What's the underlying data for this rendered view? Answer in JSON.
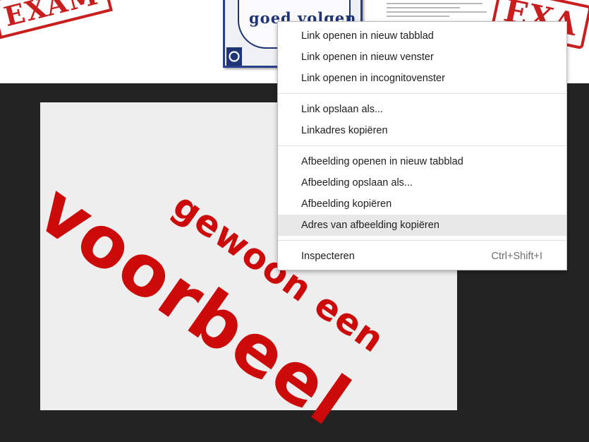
{
  "thumbnails": {
    "left_stamp": "EXAM",
    "tile_text": "goed volgen",
    "right_stamp": "EXA"
  },
  "main_image": {
    "line1": "gewoon een",
    "line2": "voorbeel"
  },
  "context_menu": {
    "groups": [
      [
        {
          "label": "Link openen in nieuw tabblad"
        },
        {
          "label": "Link openen in nieuw venster"
        },
        {
          "label": "Link openen in incognitovenster"
        }
      ],
      [
        {
          "label": "Link opslaan als..."
        },
        {
          "label": "Linkadres kopiëren"
        }
      ],
      [
        {
          "label": "Afbeelding openen in nieuw tabblad"
        },
        {
          "label": "Afbeelding opslaan als..."
        },
        {
          "label": "Afbeelding kopiëren"
        },
        {
          "label": "Adres van afbeelding kopiëren",
          "highlighted": true
        }
      ],
      [
        {
          "label": "Inspecteren",
          "shortcut": "Ctrl+Shift+I"
        }
      ]
    ]
  },
  "colors": {
    "stamp_red": "#c81e1e",
    "image_red": "#cc0a0a",
    "delft_blue": "#1f3474",
    "backdrop": "#232323"
  }
}
